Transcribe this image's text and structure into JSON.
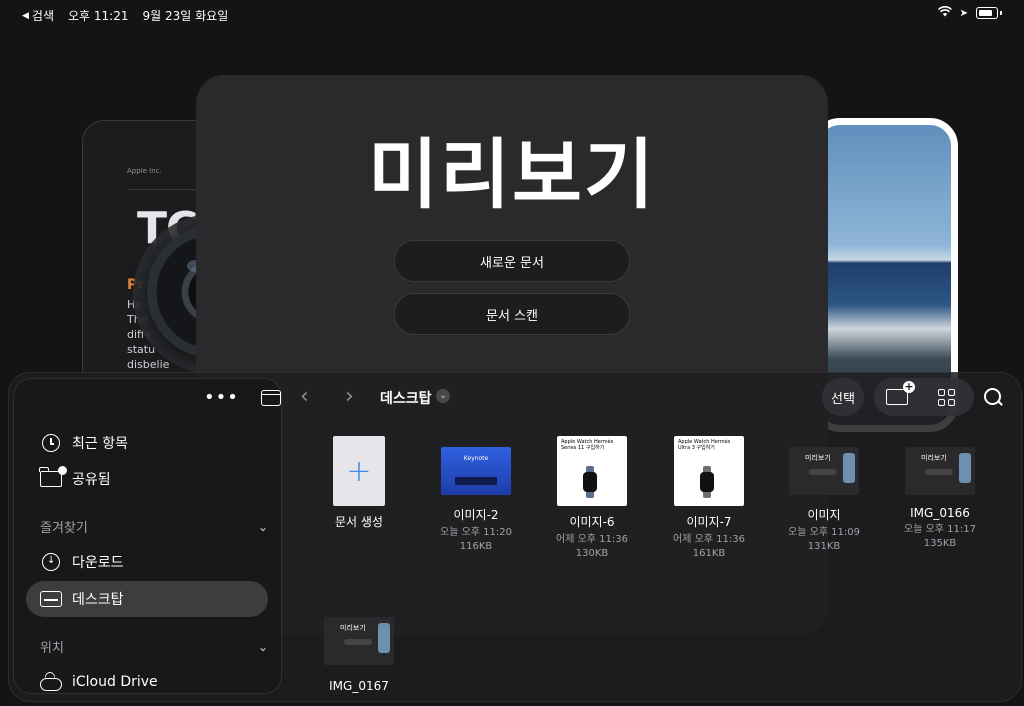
{
  "status_bar": {
    "back_label": "검색",
    "time": "오후 11:21",
    "date": "9월 23일 화요일"
  },
  "background": {
    "doc_left": {
      "company": "Apple Inc.",
      "big_text": "TC",
      "orange_text": "Pr",
      "lines": [
        "He",
        "The",
        "diffe",
        "statu",
        "disbelie"
      ]
    },
    "lens_text": "PREVIEW.APP"
  },
  "title_panel": {
    "app_title": "미리보기",
    "new_document": "새로운 문서",
    "scan_document": "문서 스캔"
  },
  "sidebar": {
    "items": [
      {
        "label": "최근 항목",
        "icon": "clock-icon"
      },
      {
        "label": "공유됨",
        "icon": "shared-folder-icon"
      }
    ],
    "favorites_header": "즐겨찾기",
    "favorites": [
      {
        "label": "다운로드",
        "icon": "download-icon"
      },
      {
        "label": "데스크탑",
        "icon": "desktop-icon"
      }
    ],
    "locations_header": "위치",
    "locations": [
      {
        "label": "iCloud Drive",
        "icon": "cloud-icon"
      }
    ]
  },
  "toolbar": {
    "location": "데스크탑",
    "select_label": "선택"
  },
  "files": [
    {
      "name": "문서 생성",
      "date": "",
      "size": "",
      "thumb": "new-document"
    },
    {
      "name": "이미지-2",
      "date": "오늘 오후 11:20",
      "size": "116KB",
      "thumb": "keynote",
      "thumb_text": "Keynote"
    },
    {
      "name": "이미지-6",
      "date": "어제 오후 11:36",
      "size": "130KB",
      "thumb": "apple-watch-page",
      "thumb_text": "Apple Watch Hermès Series 11 구입하기"
    },
    {
      "name": "이미지-7",
      "date": "어제 오후 11:36",
      "size": "161KB",
      "thumb": "apple-watch-page",
      "thumb_text": "Apple Watch Hermès Ultra 3 구입하기"
    },
    {
      "name": "이미지",
      "date": "오늘 오후 11:09",
      "size": "131KB",
      "thumb": "preview-screenshot",
      "thumb_text": "미리보기"
    },
    {
      "name": "IMG_0166",
      "date": "오늘 오후 11:17",
      "size": "135KB",
      "thumb": "preview-screenshot",
      "thumb_text": "미리보기"
    },
    {
      "name": "IMG_0167",
      "date": "",
      "size": "",
      "thumb": "preview-screenshot",
      "thumb_text": "미리보기"
    }
  ],
  "colors": {
    "background": "#141416",
    "panel": "#2a2a2c",
    "accent_orange": "#e8843c",
    "accent_blue": "#3a8ee6"
  }
}
